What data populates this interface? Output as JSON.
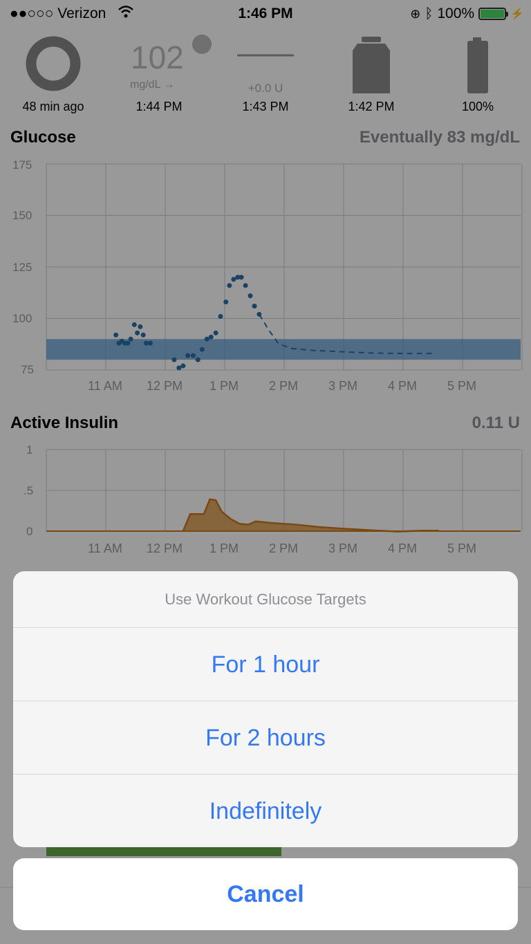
{
  "status_bar": {
    "carrier": "●●○○○ Verizon",
    "time": "1:46 PM",
    "battery": "100%"
  },
  "hud": {
    "loop_age": "48 min ago",
    "glucose_value": "102",
    "glucose_unit": "mg/dL →",
    "glucose_time": "1:44 PM",
    "basal_delta": "+0.0 U",
    "basal_time": "1:43 PM",
    "reservoir_time": "1:42 PM",
    "pump_battery": "100%"
  },
  "glucose_section": {
    "title": "Glucose",
    "eventual": "Eventually 83 mg/dL"
  },
  "insulin_section": {
    "title": "Active Insulin",
    "value": "0.11 U"
  },
  "glucose_chart": {
    "type": "scatter",
    "title": "Glucose",
    "y_ticks": [
      "175",
      "150",
      "125",
      "100",
      "75"
    ],
    "x_ticks": [
      "11 AM",
      "12 PM",
      "1 PM",
      "2 PM",
      "3 PM",
      "4 PM",
      "5 PM"
    ],
    "ylim": [
      75,
      175
    ],
    "target_range": [
      80,
      90
    ],
    "colors": {
      "points": "#2e6fa8",
      "target": "#5b9bd5",
      "prediction": "#2e6fa8"
    },
    "x_unit": "hours since 10:00 AM",
    "points": [
      [
        1.17,
        92
      ],
      [
        1.22,
        88
      ],
      [
        1.27,
        89
      ],
      [
        1.32,
        88
      ],
      [
        1.37,
        88
      ],
      [
        1.42,
        90
      ],
      [
        1.48,
        97
      ],
      [
        1.53,
        93
      ],
      [
        1.58,
        96
      ],
      [
        1.63,
        92
      ],
      [
        1.68,
        88
      ],
      [
        1.75,
        88
      ],
      [
        2.15,
        80
      ],
      [
        2.23,
        76
      ],
      [
        2.3,
        77
      ],
      [
        2.38,
        82
      ],
      [
        2.47,
        82
      ],
      [
        2.55,
        80
      ],
      [
        2.62,
        85
      ],
      [
        2.7,
        90
      ],
      [
        2.77,
        91
      ],
      [
        2.85,
        93
      ],
      [
        2.93,
        101
      ],
      [
        3.02,
        108
      ],
      [
        3.08,
        116
      ],
      [
        3.15,
        119
      ],
      [
        3.22,
        120
      ],
      [
        3.28,
        120
      ],
      [
        3.35,
        116
      ],
      [
        3.43,
        111
      ],
      [
        3.5,
        106
      ],
      [
        3.58,
        102
      ]
    ],
    "prediction": [
      [
        3.58,
        102
      ],
      [
        3.75,
        94
      ],
      [
        3.9,
        88
      ],
      [
        4.1,
        85.5
      ],
      [
        4.5,
        84.5
      ],
      [
        5.0,
        83.8
      ],
      [
        5.5,
        83.2
      ],
      [
        6.0,
        83
      ],
      [
        6.5,
        83
      ]
    ]
  },
  "insulin_chart": {
    "type": "area",
    "title": "Active Insulin",
    "y_ticks": [
      "1",
      ".5",
      "0"
    ],
    "x_ticks": [
      "11 AM",
      "12 PM",
      "1 PM",
      "2 PM",
      "3 PM",
      "4 PM",
      "5 PM"
    ],
    "ylim": [
      0,
      1
    ],
    "colors": {
      "line": "#c97a1f",
      "fill": "#d99a4a"
    },
    "x_unit": "hours since 10:00 AM",
    "series": [
      [
        2.3,
        0
      ],
      [
        2.42,
        0.21
      ],
      [
        2.55,
        0.21
      ],
      [
        2.65,
        0.21
      ],
      [
        2.75,
        0.39
      ],
      [
        2.85,
        0.38
      ],
      [
        2.95,
        0.24
      ],
      [
        3.1,
        0.15
      ],
      [
        3.25,
        0.09
      ],
      [
        3.4,
        0.08
      ],
      [
        3.52,
        0.12
      ],
      [
        3.8,
        0.1
      ],
      [
        4.2,
        0.08
      ],
      [
        4.6,
        0.05
      ],
      [
        5.0,
        0.03
      ],
      [
        5.5,
        0.01
      ],
      [
        5.9,
        -0.005
      ],
      [
        6.3,
        0.005
      ],
      [
        6.6,
        0.005
      ]
    ]
  },
  "action_sheet": {
    "title": "Use Workout Glucose Targets",
    "options": [
      "For 1 hour",
      "For 2 hours",
      "Indefinitely"
    ],
    "cancel": "Cancel"
  }
}
